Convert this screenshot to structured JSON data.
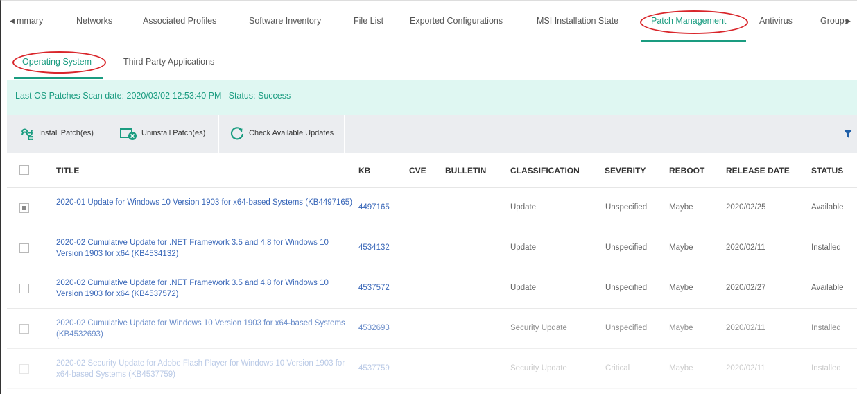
{
  "top_tabs": [
    {
      "label": "mmary"
    },
    {
      "label": "Networks"
    },
    {
      "label": "Associated Profiles"
    },
    {
      "label": "Software Inventory"
    },
    {
      "label": "File List"
    },
    {
      "label": "Exported Configurations"
    },
    {
      "label": "MSI Installation State"
    },
    {
      "label": "Patch Management"
    },
    {
      "label": "Antivirus"
    },
    {
      "label": "Groups"
    }
  ],
  "sub_tabs": [
    {
      "label": "Operating System"
    },
    {
      "label": "Third Party Applications"
    }
  ],
  "banner": {
    "text": "Last OS Patches Scan date: 2020/03/02 12:53:40 PM | Status: Success"
  },
  "toolbar": {
    "install_label": "Install Patch(es)",
    "uninstall_label": "Uninstall Patch(es)",
    "check_label": "Check Available Updates"
  },
  "table": {
    "headers": {
      "title": "TITLE",
      "kb": "KB",
      "cve": "CVE",
      "bulletin": "BULLETIN",
      "classification": "CLASSIFICATION",
      "severity": "SEVERITY",
      "reboot": "REBOOT",
      "release_date": "RELEASE DATE",
      "status": "STATUS"
    },
    "rows": [
      {
        "title": "2020-01 Update for Windows 10 Version 1903 for x64-based Systems (KB4497165)",
        "kb": "4497165",
        "classification": "Update",
        "severity": "Unspecified",
        "reboot": "Maybe",
        "release_date": "2020/02/25",
        "status": "Available"
      },
      {
        "title": "2020-02 Cumulative Update for .NET Framework 3.5 and 4.8 for Windows 10 Version 1903 for x64 (KB4534132)",
        "kb": "4534132",
        "classification": "Update",
        "severity": "Unspecified",
        "reboot": "Maybe",
        "release_date": "2020/02/11",
        "status": "Installed"
      },
      {
        "title": "2020-02 Cumulative Update for .NET Framework 3.5 and 4.8 for Windows 10 Version 1903 for x64 (KB4537572)",
        "kb": "4537572",
        "classification": "Update",
        "severity": "Unspecified",
        "reboot": "Maybe",
        "release_date": "2020/02/27",
        "status": "Available"
      },
      {
        "title": "2020-02 Cumulative Update for Windows 10 Version 1903 for x64-based Systems (KB4532693)",
        "kb": "4532693",
        "classification": "Security Update",
        "severity": "Unspecified",
        "reboot": "Maybe",
        "release_date": "2020/02/11",
        "status": "Installed"
      },
      {
        "title": "2020-02 Security Update for Adobe Flash Player for Windows 10 Version 1903 for x64-based Systems (KB4537759)",
        "kb": "4537759",
        "classification": "Security Update",
        "severity": "Critical",
        "reboot": "Maybe",
        "release_date": "2020/02/11",
        "status": "Installed"
      }
    ]
  },
  "colors": {
    "accent": "#1a9c80",
    "link": "#3866b8",
    "highlight": "#d9262b",
    "banner_bg": "#dff7f2",
    "toolbar_bg": "#ebedf0"
  }
}
